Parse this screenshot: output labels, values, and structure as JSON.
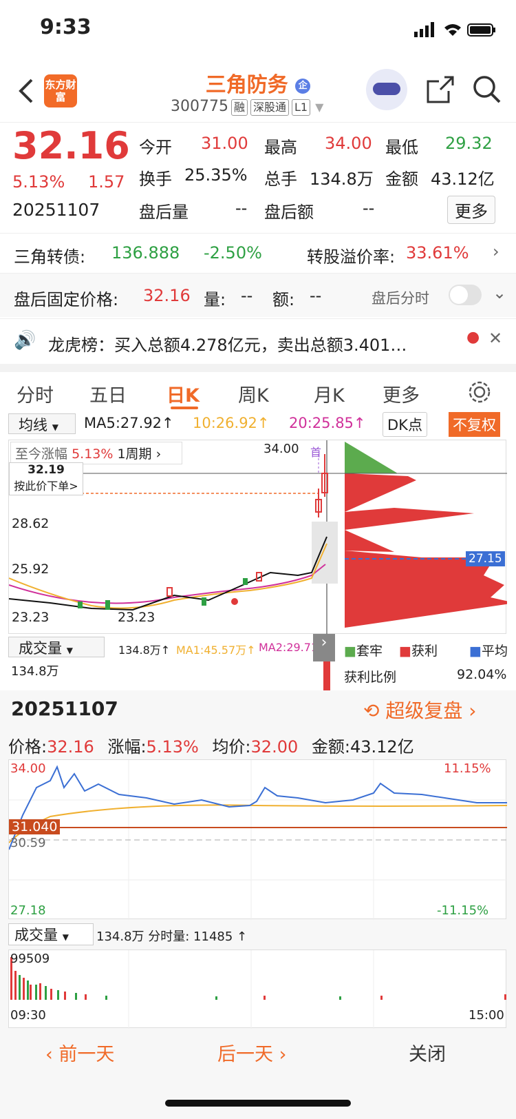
{
  "status": {
    "time": "9:33"
  },
  "header": {
    "logo": "东方财富",
    "title": "三角防务",
    "badge": "企",
    "code": "300775",
    "tags": [
      "融",
      "深股通",
      "L1"
    ]
  },
  "quote": {
    "price": "32.16",
    "pct": "5.13%",
    "chg": "1.57",
    "date": "20251107",
    "open_l": "今开",
    "open_v": "31.00",
    "high_l": "最高",
    "high_v": "34.00",
    "low_l": "最低",
    "low_v": "29.32",
    "turn_l": "换手",
    "turn_v": "25.35%",
    "vol_l": "总手",
    "vol_v": "134.8万",
    "amt_l": "金额",
    "amt_v": "43.12亿",
    "ah_vol_l": "盘后量",
    "ah_vol_v": "--",
    "ah_amt_l": "盘后额",
    "ah_amt_v": "--",
    "more": "更多"
  },
  "bond": {
    "label": "三角转债:",
    "price": "136.888",
    "pct": "-2.50%",
    "prem_l": "转股溢价率:",
    "prem_v": "33.61%"
  },
  "afterhours": {
    "label": "盘后固定价格:",
    "price": "32.16",
    "vol_l": "量:",
    "vol_v": "--",
    "amt_l": "额:",
    "amt_v": "--",
    "toggle_l": "盘后分时"
  },
  "notice": {
    "text": "龙虎榜：买入总额4.278亿元，卖出总额3.401…"
  },
  "tabs": [
    "分时",
    "五日",
    "日K",
    "周K",
    "月K",
    "更多"
  ],
  "kline": {
    "ma_select": "均线",
    "ma5": "MA5:27.92↑",
    "ma10": "10:26.92↑",
    "ma20": "20:25.85↑",
    "dk": "DK点",
    "fq": "不复权",
    "rise_l": "至今涨幅",
    "rise_v": "5.13%",
    "period": "1周期",
    "cursor_price": "32.19",
    "cursor_tip": "按此价下单>",
    "high_mark": "34.00",
    "first": "首",
    "axis": [
      "28.62",
      "25.92",
      "23.23"
    ],
    "low_mark": "23.23",
    "chip_avg": "27.15",
    "vol_select": "成交量",
    "vol_total": "134.8万↑",
    "vma1": "MA1:45.57万↑",
    "vma2": "MA2:29.71",
    "vol_axis": "134.8万",
    "legend": [
      "套牢",
      "获利",
      "平均"
    ],
    "profit_l": "获利比例",
    "profit_v": "92.04%"
  },
  "intraday": {
    "date": "20251107",
    "replay": "超级复盘",
    "price_l": "价格:",
    "price_v": "32.16",
    "pct_l": "涨幅:",
    "pct_v": "5.13%",
    "avg_l": "均价:",
    "avg_v": "32.00",
    "amt_l": "金额:",
    "amt_v": "43.12亿",
    "top": "34.00",
    "top_pct": "11.15%",
    "base": "31.040",
    "mid": "30.59",
    "bot": "27.18",
    "bot_pct": "-11.15%",
    "vol_select": "成交量",
    "vol_info": "134.8万 分时量: 11485 ↑",
    "vol_max": "99509",
    "t0": "09:30",
    "t1": "15:00"
  },
  "footer": {
    "prev": "前一天",
    "next": "后一天",
    "close": "关闭"
  }
}
